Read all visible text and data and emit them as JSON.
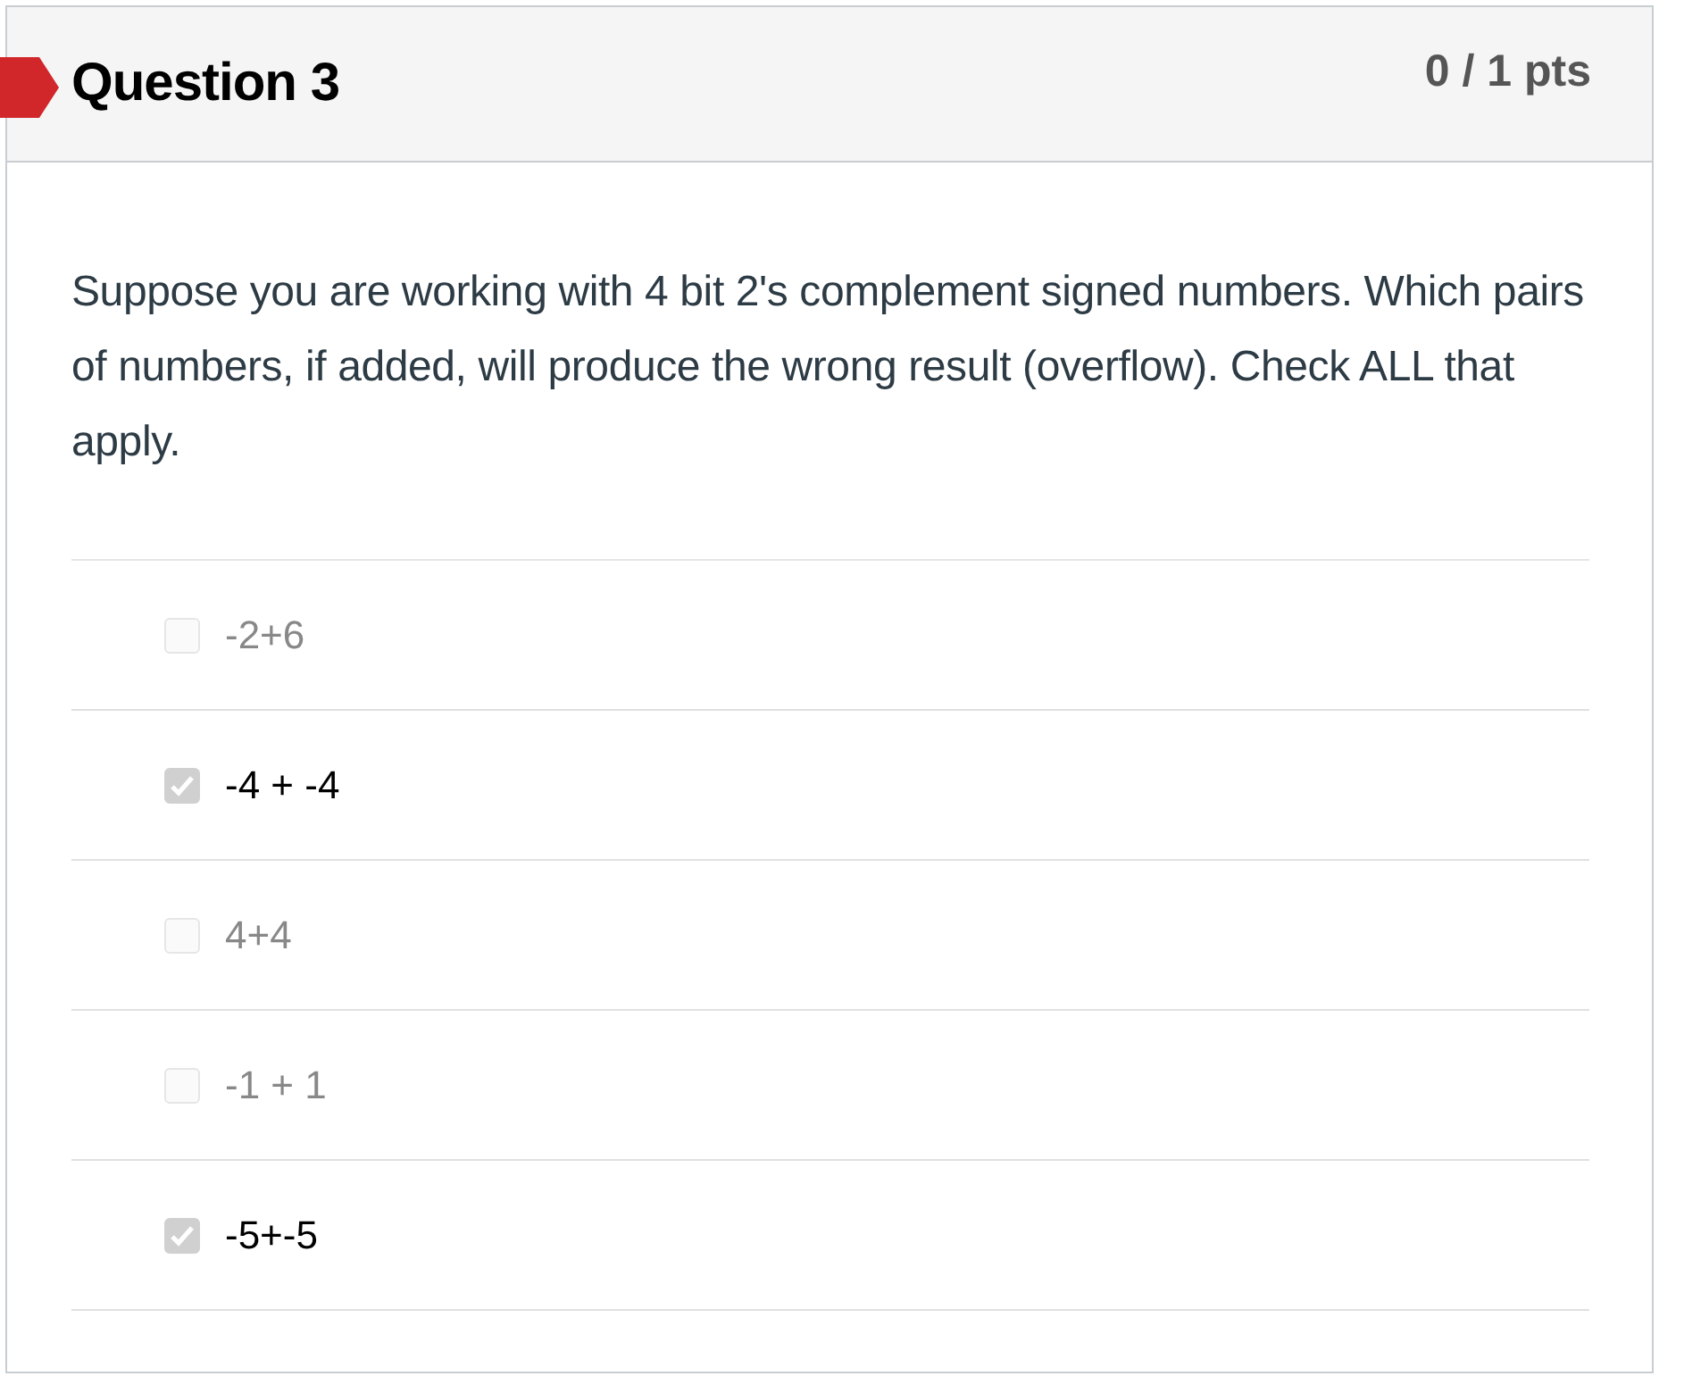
{
  "question": {
    "title": "Question 3",
    "points": "0 / 1 pts",
    "flagged": true
  },
  "prompt": "Suppose you are working with 4 bit 2's complement signed numbers. Which pairs of numbers, if added, will produce the wrong result (overflow).  Check ALL that apply.",
  "answers": [
    {
      "label": "-2+6",
      "checked": false
    },
    {
      "label": "-4 + -4",
      "checked": true
    },
    {
      "label": "4+4",
      "checked": false
    },
    {
      "label": "-1 + 1",
      "checked": false
    },
    {
      "label": "-5+-5",
      "checked": true
    }
  ]
}
